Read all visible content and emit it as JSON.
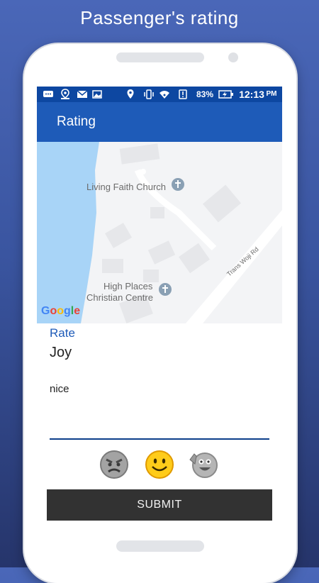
{
  "promo": {
    "title": "Passenger's rating"
  },
  "status_bar": {
    "battery": "83%",
    "time": "12:13",
    "ampm": "PM",
    "icons": [
      "chat-icon",
      "location-user-icon",
      "gmail-icon",
      "image-icon",
      "location-pin-icon",
      "vibrate-icon",
      "wifi-icon",
      "alert-icon",
      "battery-icon"
    ]
  },
  "app_bar": {
    "title": "Rating"
  },
  "map": {
    "poi_1": "Living Faith Church",
    "poi_2_line1": "High Places",
    "poi_2_line2": "Christian Centre",
    "road": "Trans Woji Rd",
    "attribution": [
      "G",
      "o",
      "o",
      "g",
      "l",
      "e"
    ],
    "colors": {
      "water": "#a8d4f7",
      "land": "#f3f4f6",
      "road": "#ffffff",
      "building": "#e6e7ea",
      "poi": "#8aa0b4"
    }
  },
  "form": {
    "rate_label": "Rate",
    "name": "Joy",
    "comment": "nice"
  },
  "emojis": [
    "angry-face-icon",
    "smiley-face-icon",
    "waving-face-icon"
  ],
  "submit_label": "SUBMIT",
  "colors": {
    "primary": "#1e5bb8",
    "status": "#0d47a1",
    "button": "#323232",
    "label": "#1e5bb8"
  }
}
